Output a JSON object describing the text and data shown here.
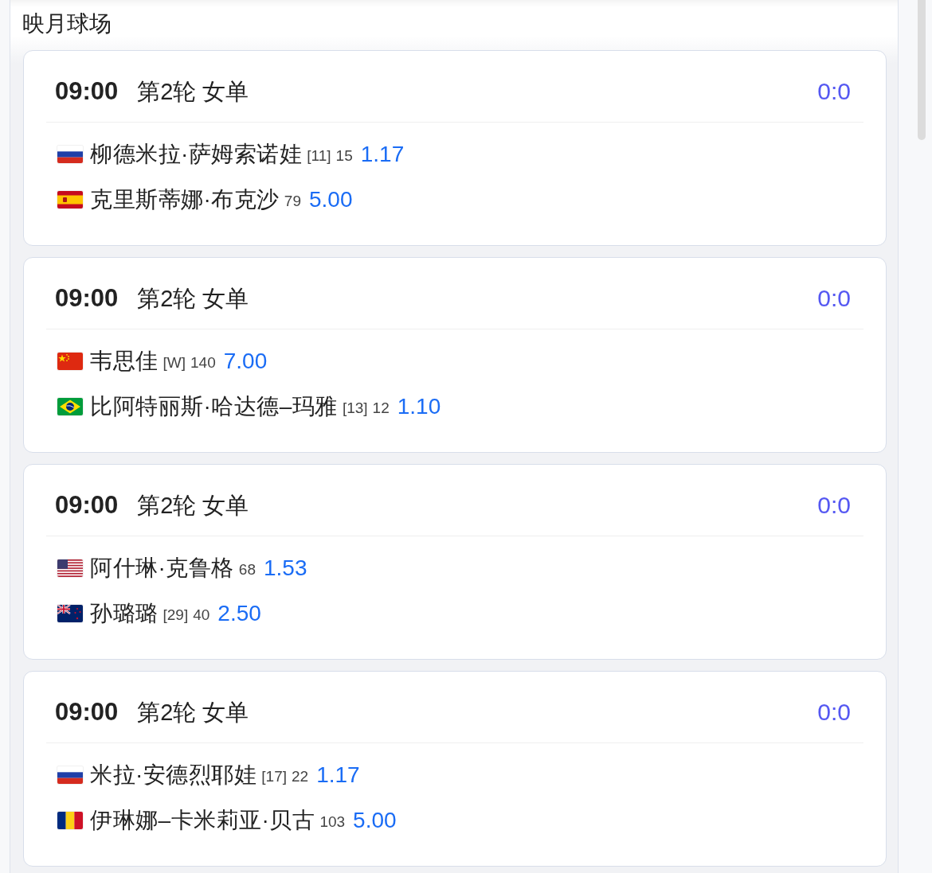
{
  "venue": {
    "title": "映月球场"
  },
  "matches": [
    {
      "time": "09:00",
      "round": "第2轮 女单",
      "score": "0:0",
      "players": [
        {
          "kind": "ru",
          "name": "柳德米拉·萨姆索诺娃",
          "seed": "[11]",
          "rank": "15",
          "odds": "1.17"
        },
        {
          "kind": "es",
          "name": "克里斯蒂娜·布克沙",
          "rank": "79",
          "odds": "5.00"
        }
      ]
    },
    {
      "time": "09:00",
      "round": "第2轮 女单",
      "score": "0:0",
      "players": [
        {
          "kind": "cn",
          "name": "韦思佳",
          "seed": "[W]",
          "rank": "140",
          "odds": "7.00"
        },
        {
          "kind": "br",
          "name": "比阿特丽斯·哈达德–玛雅",
          "seed": "[13]",
          "rank": "12",
          "odds": "1.10"
        }
      ]
    },
    {
      "time": "09:00",
      "round": "第2轮 女单",
      "score": "0:0",
      "players": [
        {
          "kind": "us",
          "name": "阿什琳·克鲁格",
          "rank": "68",
          "odds": "1.53"
        },
        {
          "kind": "nz",
          "name": "孙璐璐",
          "seed": "[29]",
          "rank": "40",
          "odds": "2.50"
        }
      ]
    },
    {
      "time": "09:00",
      "round": "第2轮 女单",
      "score": "0:0",
      "players": [
        {
          "kind": "ru",
          "name": "米拉·安德烈耶娃",
          "seed": "[17]",
          "rank": "22",
          "odds": "1.17"
        },
        {
          "kind": "ro",
          "name": "伊琳娜–卡米莉亚·贝古",
          "rank": "103",
          "odds": "5.00"
        }
      ]
    }
  ]
}
